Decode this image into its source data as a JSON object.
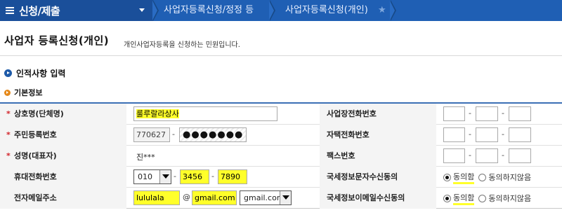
{
  "topbar": {
    "menu_title": "신청/제출",
    "breadcrumb_1": "사업자등록신청/정정 등",
    "breadcrumb_2": "사업자등록신청(개인)",
    "star_glyph": "★"
  },
  "page": {
    "title": "사업자 등록신청(개인)",
    "description": "개인사업자등록을 신청하는 민원입니다."
  },
  "section": {
    "title": "인적사항 입력",
    "subtitle": "기본정보"
  },
  "required_mark": "*",
  "form": {
    "business_name": {
      "label": "상호명(단체명)",
      "value": "룰루랄라상사"
    },
    "resident_number": {
      "label": "주민등록번호",
      "front": "770627",
      "back": "●●●●●●●"
    },
    "representative": {
      "label": "성명(대표자)",
      "value": "진***"
    },
    "mobile": {
      "label": "휴대전화번호",
      "prefix": "010",
      "middle": "3456",
      "last": "7890"
    },
    "email": {
      "label": "전자메일주소",
      "id": "lululala",
      "at": "@",
      "domain": "gmail.com",
      "domain_select": "gmail.com"
    },
    "business_phone": {
      "label": "사업장전화번호"
    },
    "home_phone": {
      "label": "자택전화번호"
    },
    "fax": {
      "label": "팩스번호"
    },
    "tax_sms_consent": {
      "label": "국세정보문자수신동의",
      "agree": "동의함",
      "disagree": "동의하지않음",
      "selected": "agree"
    },
    "tax_email_consent": {
      "label": "국세정보이메일수신동의",
      "agree": "동의함",
      "disagree": "동의하지않음",
      "selected": "agree"
    }
  },
  "dash": "-",
  "colors": {
    "topbar": "#1f5fb4",
    "highlight": "#ffff2a",
    "required": "#d2232a"
  }
}
